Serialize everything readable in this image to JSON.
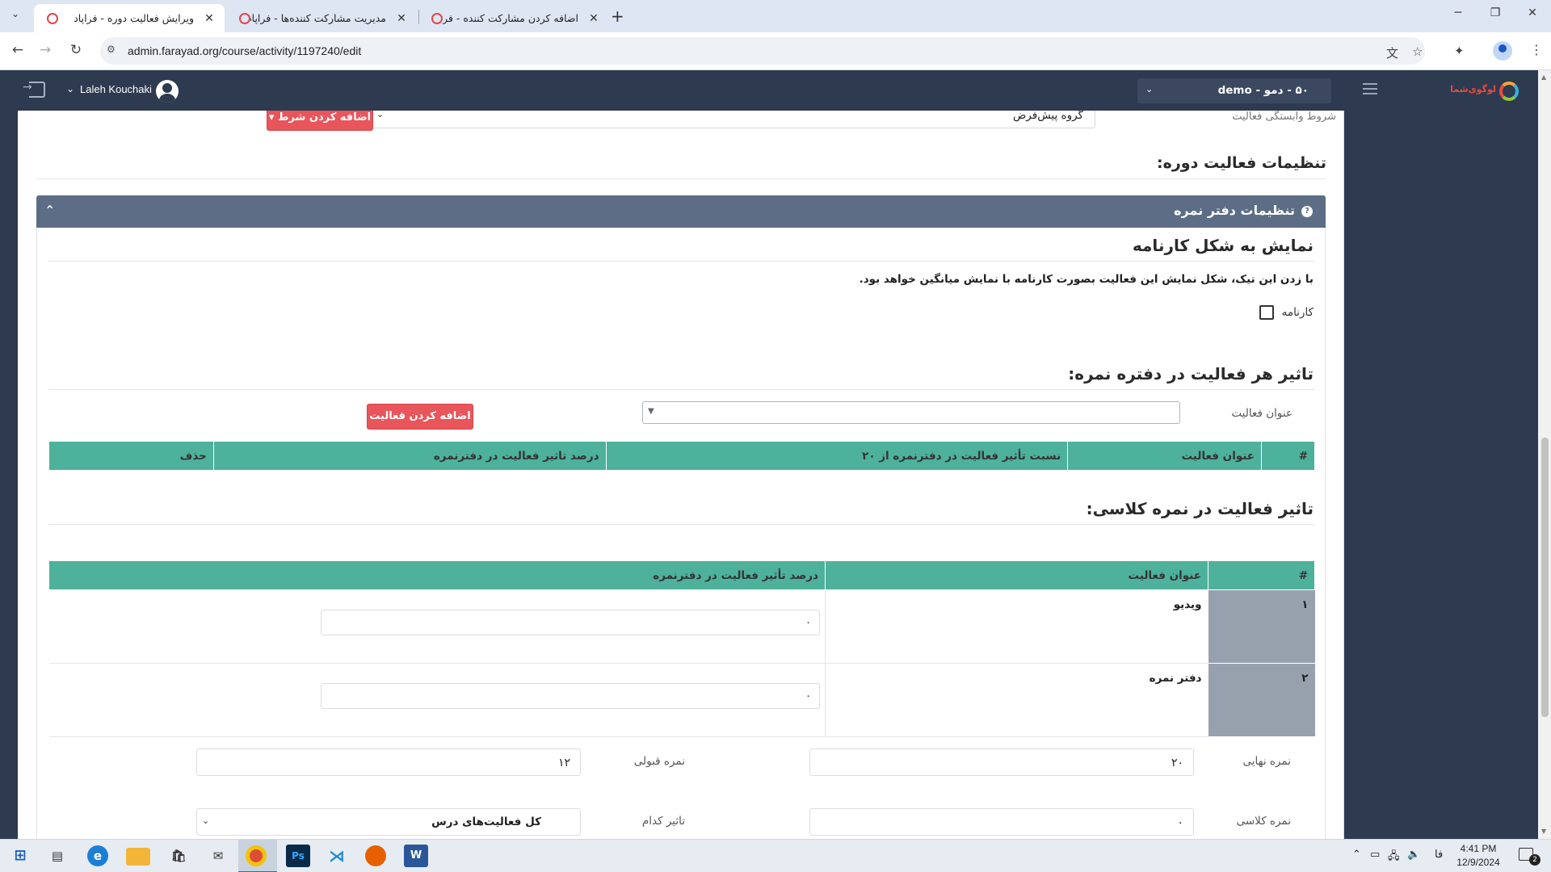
{
  "browser": {
    "tabs": [
      {
        "title": "ویرایش فعالیت دوره - فراپاد",
        "active": true
      },
      {
        "title": "مدیریت مشارکت کننده‌ها - فراپاد",
        "active": false
      },
      {
        "title": "اضافه کردن مشارکت کننده - فراپا",
        "active": false
      }
    ],
    "url": "admin.farayad.org/course/activity/1197240/edit"
  },
  "header": {
    "user_name": "Laleh Kouchaki",
    "org_selector": "۵۰ - دمو - demo",
    "brand_text": "لوگوی‌شما"
  },
  "dependency": {
    "label": "شروط وابستگی فعالیت",
    "group_value": "گروه پیش‌فرض",
    "add_condition": "اضافه کردن شرط"
  },
  "course_settings_title": "تنظیمات فعالیت دوره:",
  "gradebook_panel": {
    "title": "تنظیمات دفتر نمره",
    "help_icon": "?",
    "report_card": {
      "title": "نمایش به شکل کارنامه",
      "description": "با زدن این تیک، شکل نمایش این فعالیت بصورت کارنامه با نمایش میانگین خواهد بود.",
      "checkbox_label": "کارنامه",
      "checked": false
    },
    "activity_impact": {
      "title": "تاثیر هر فعالیت در دفتره نمره:",
      "activity_title_label": "عنوان فعالیت",
      "activity_select_value": "",
      "add_activity": "اضافه کردن فعالیت",
      "columns": [
        "#",
        "عنوان فعالیت",
        "نسبت تأثیر فعالیت در دفترنمره از ۲۰",
        "درصد تاثیر فعالیت در دفترنمره",
        "حذف"
      ],
      "rows": []
    },
    "class_grade_impact": {
      "title": "تاثیر فعالیت در نمره کلاسی:",
      "columns": [
        "#",
        "عنوان فعالیت",
        "درصد تأثیر فعالیت در دفترنمره"
      ],
      "rows": [
        {
          "index": "۱",
          "name": "ویدیو",
          "value": "۰"
        },
        {
          "index": "۲",
          "name": "دفتر نمره",
          "value": "۰"
        }
      ]
    },
    "grades": {
      "final_grade_label": "نمره نهایی",
      "final_grade_value": "۲۰",
      "passing_grade_label": "نمره قبولی",
      "passing_grade_value": "۱۲",
      "class_grade_label": "نمره کلاسی",
      "class_grade_value": "۰",
      "which_impact_label": "تاثیر کدام",
      "which_impact_value": "کل فعالیت‌های درس"
    }
  },
  "taskbar": {
    "ime": "فا",
    "time": "4:41 PM",
    "date": "12/9/2024",
    "notifications": "2"
  }
}
